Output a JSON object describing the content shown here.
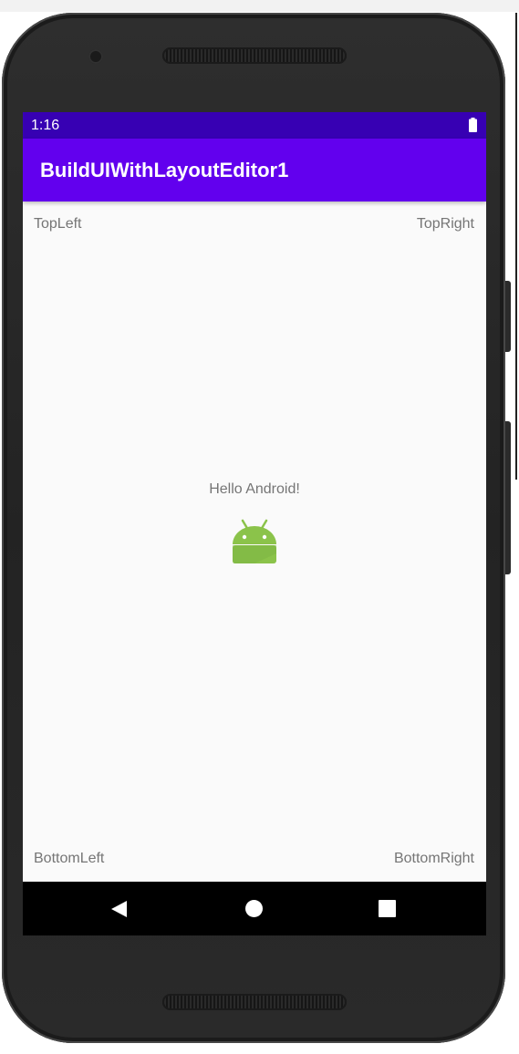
{
  "status_bar": {
    "time": "1:16",
    "battery_icon": "battery-full-icon",
    "background_color": "#3700b3"
  },
  "app_bar": {
    "title": "BuildUIWithLayoutEditor1",
    "background_color": "#6200ee"
  },
  "content": {
    "top_left": "TopLeft",
    "top_right": "TopRight",
    "center_text": "Hello Android!",
    "center_icon": "android-robot-icon",
    "bottom_left": "BottomLeft",
    "bottom_right": "BottomRight"
  },
  "nav_bar": {
    "back_icon": "back-triangle-icon",
    "home_icon": "home-circle-icon",
    "recents_icon": "recents-square-icon"
  }
}
